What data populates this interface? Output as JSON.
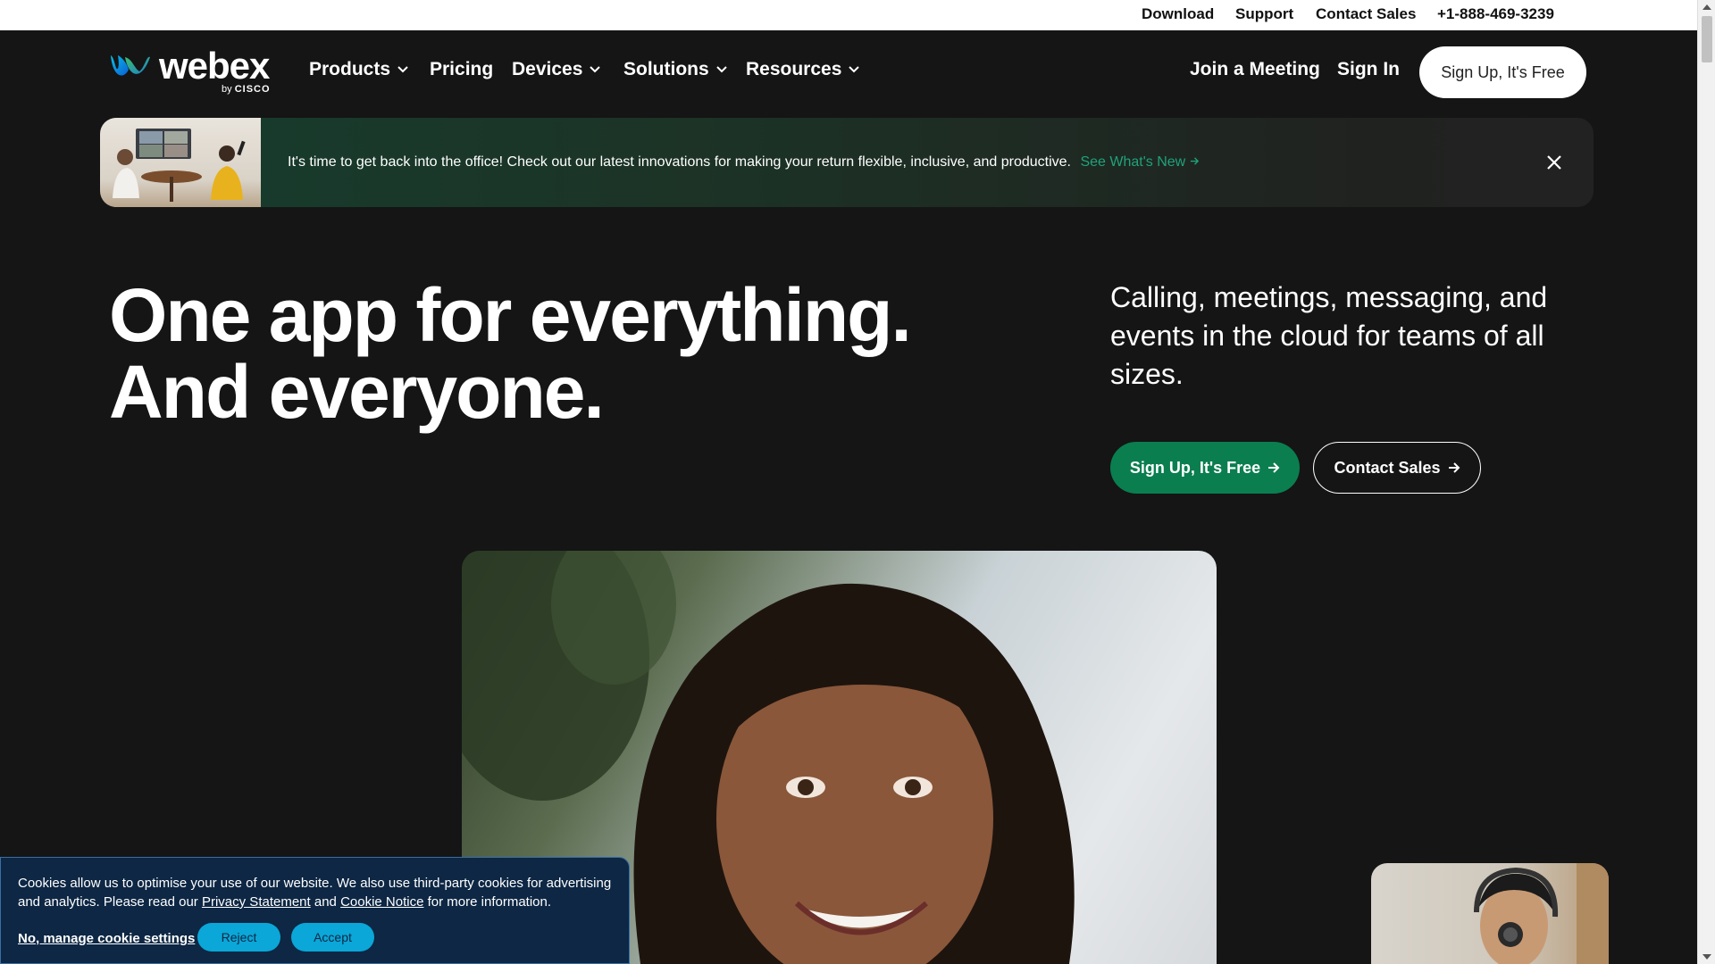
{
  "utility_nav": {
    "download": "Download",
    "support": "Support",
    "contact_sales": "Contact Sales",
    "phone": "+1-888-469-3239"
  },
  "logo": {
    "word": "webex",
    "by": "by",
    "brand": "CISCO"
  },
  "main_nav": {
    "products": "Products",
    "pricing": "Pricing",
    "devices": "Devices",
    "solutions": "Solutions",
    "resources": "Resources",
    "join_meeting": "Join a Meeting",
    "sign_in": "Sign In",
    "sign_up": "Sign Up, It's Free"
  },
  "banner": {
    "text": "It's time to get back into the office! Check out our latest innovations for making your return flexible, inclusive, and productive.",
    "link": "See What's New"
  },
  "hero": {
    "title_line1": "One app for everything.",
    "title_line2": "And everyone.",
    "subtitle": "Calling, meetings, messaging, and events in the cloud for teams of all sizes.",
    "cta_primary": "Sign Up, It's Free",
    "cta_secondary": "Contact Sales"
  },
  "cookie": {
    "text_part1": "Cookies allow us to optimise your use of our website. We also use third-party cookies for advertising and analytics. Please read our",
    "privacy_link": "Privacy Statement",
    "and": "and",
    "cookie_link": "Cookie Notice",
    "text_part2": "for more information.",
    "manage": "No, manage cookie settings",
    "reject": "Reject",
    "accept": "Accept"
  },
  "colors": {
    "background": "#151515",
    "brand_green": "#0a7e4f",
    "link_green": "#1fa37a",
    "cookie_bg": "#0d2744",
    "cookie_button": "#0aa7d8"
  }
}
